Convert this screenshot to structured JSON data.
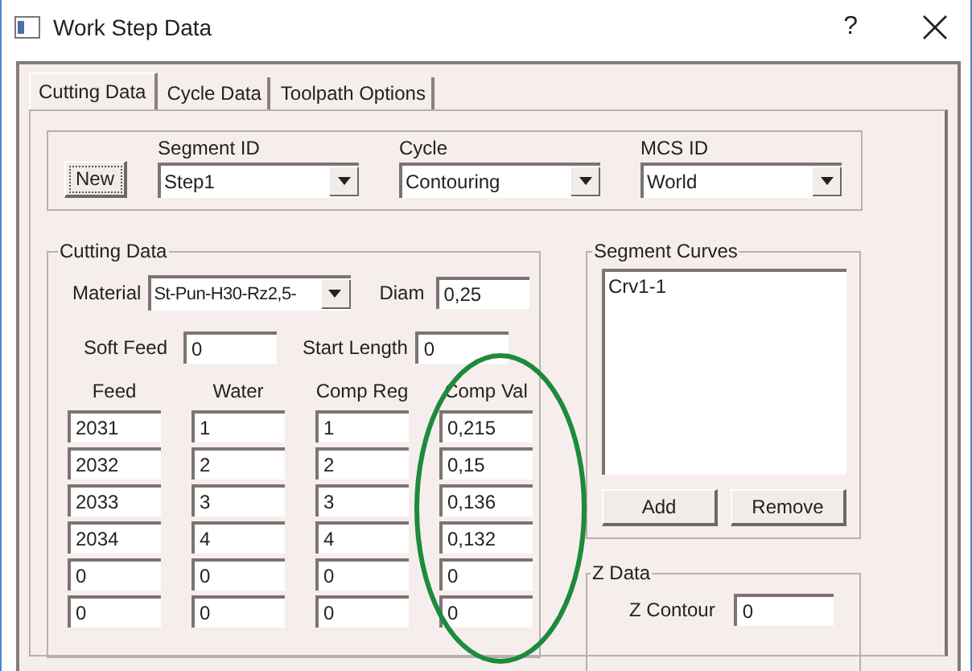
{
  "window": {
    "title": "Work Step Data",
    "help": "?"
  },
  "tabs": [
    {
      "label": "Cutting Data",
      "selected": true
    },
    {
      "label": "Cycle Data",
      "selected": false
    },
    {
      "label": "Toolpath Options",
      "selected": false
    }
  ],
  "header": {
    "new_button": "New",
    "combos": [
      {
        "label": "Segment ID",
        "value": "Step1"
      },
      {
        "label": "Cycle",
        "value": "Contouring"
      },
      {
        "label": "MCS ID",
        "value": "World"
      }
    ]
  },
  "cutting_data": {
    "title": "Cutting Data",
    "material": {
      "label": "Material",
      "value": "St-Pun-H30-Rz2,5-"
    },
    "diam": {
      "label": "Diam",
      "value": "0,25"
    },
    "soft_feed": {
      "label": "Soft Feed",
      "value": "0"
    },
    "start_length": {
      "label": "Start Length",
      "value": "0"
    },
    "columns": [
      "Feed",
      "Water",
      "Comp Reg",
      "Comp Val"
    ],
    "rows": [
      [
        "2031",
        "1",
        "1",
        "0,215"
      ],
      [
        "2032",
        "2",
        "2",
        "0,15"
      ],
      [
        "2033",
        "3",
        "3",
        "0,136"
      ],
      [
        "2034",
        "4",
        "4",
        "0,132"
      ],
      [
        "0",
        "0",
        "0",
        "0"
      ],
      [
        "0",
        "0",
        "0",
        "0"
      ]
    ]
  },
  "segment_curves": {
    "title": "Segment Curves",
    "items": [
      "Crv1-1"
    ],
    "buttons": [
      "Add",
      "Remove"
    ]
  },
  "z_data": {
    "title": "Z Data",
    "z_contour": {
      "label": "Z Contour",
      "value": "0"
    }
  }
}
